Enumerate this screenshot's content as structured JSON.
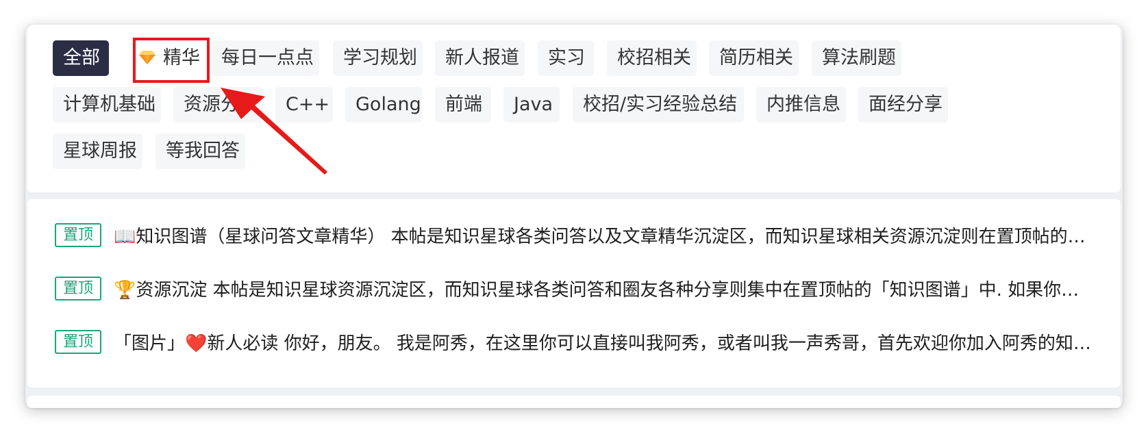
{
  "tags": {
    "all": "全部",
    "featured": "精华",
    "daily": "每日一点点",
    "study_plan": "学习规划",
    "newcomer": "新人报道",
    "internship": "实习",
    "campus_recruit": "校招相关",
    "resume": "简历相关",
    "algorithm": "算法刷题",
    "cs_basics": "计算机基础",
    "resource_share": "资源分享",
    "cpp": "C++",
    "golang": "Golang",
    "frontend": "前端",
    "java": "Java",
    "experience_summary": "校招/实习经验总结",
    "referral": "内推信息",
    "interview_share": "面经分享",
    "weekly_report": "星球周报",
    "awaiting_answer": "等我回答"
  },
  "posts": [
    {
      "badge": "置顶",
      "title": "📖知识图谱（星球问答文章精华） 本帖是知识星球各类问答以及文章精华沉淀区，而知识星球相关资源沉淀则在置顶帖的「资源沉淀」中"
    },
    {
      "badge": "置顶",
      "title": "🏆资源沉淀 本帖是知识星球资源沉淀区，而知识星球各类问答和圈友各种分享则集中在置顶帖的「知识图谱」中. 如果你有好的资源"
    },
    {
      "badge": "置顶",
      "title": "「图片」❤️新人必读 你好，朋友。 我是阿秀，在这里你可以直接叫我阿秀，或者叫我一声秀哥，首先欢迎你加入阿秀的知识星球"
    }
  ],
  "colors": {
    "active_tag_bg": "#2b2d44",
    "tag_bg": "#f5f6f8",
    "pin_green": "#1aa67a",
    "annotation_red": "#e61a1a"
  },
  "icons": {
    "featured": "gem-icon"
  }
}
